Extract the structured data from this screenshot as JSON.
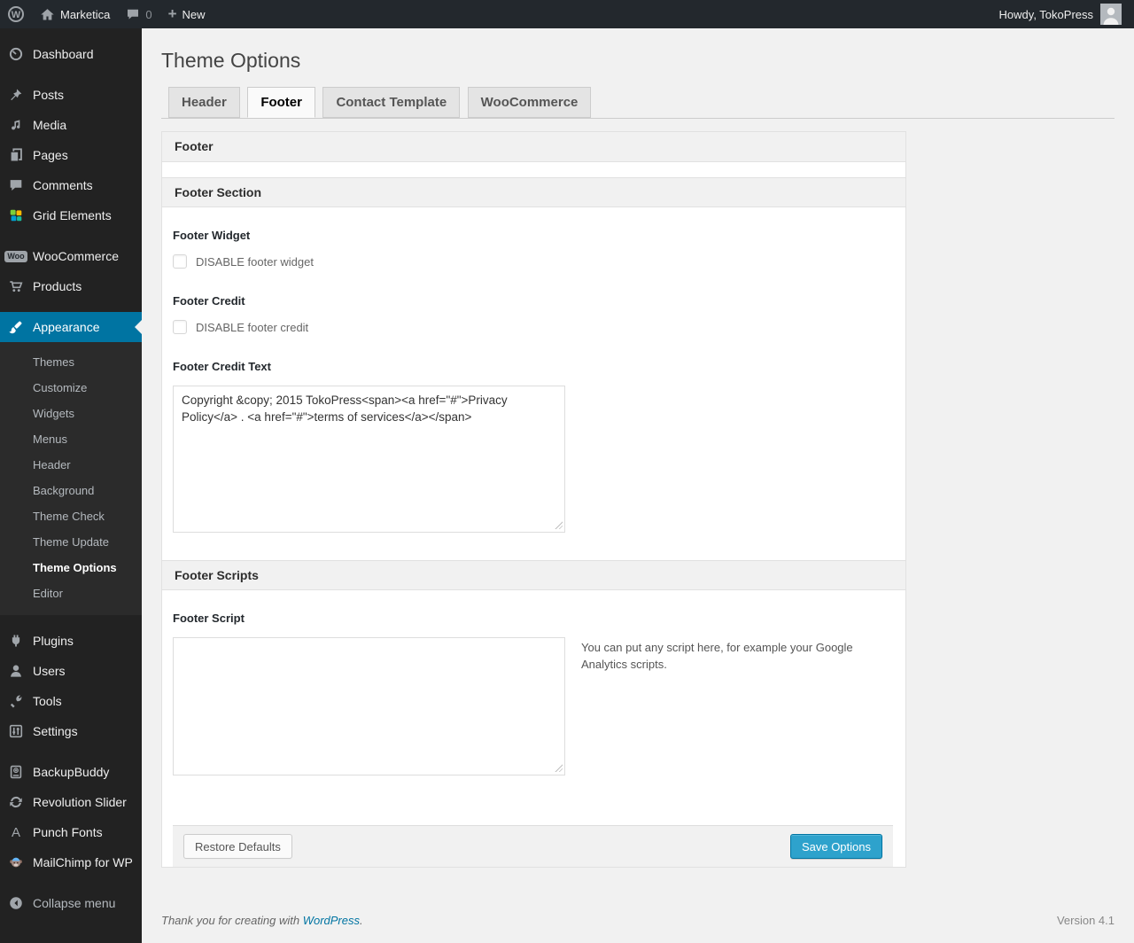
{
  "admin_bar": {
    "wp_logo_letter": "W",
    "site_name": "Marketica",
    "comment_count": "0",
    "new_plus_glyph": "+",
    "new_label": "New",
    "howdy_text": "Howdy, TokoPress"
  },
  "sidebar": {
    "items": [
      {
        "label": "Dashboard",
        "icon": "dashboard-icon"
      },
      {
        "label": "Posts",
        "icon": "pushpin-icon"
      },
      {
        "label": "Media",
        "icon": "media-icon"
      },
      {
        "label": "Pages",
        "icon": "pages-icon"
      },
      {
        "label": "Comments",
        "icon": "comment-icon"
      },
      {
        "label": "Grid Elements",
        "icon": "grid-elements-icon"
      },
      {
        "label": "WooCommerce",
        "icon": "woocommerce-badge-icon",
        "badge_text": "Woo"
      },
      {
        "label": "Products",
        "icon": "cart-icon"
      },
      {
        "label": "Appearance",
        "icon": "brush-icon",
        "active": true
      },
      {
        "label": "Plugins",
        "icon": "plug-icon"
      },
      {
        "label": "Users",
        "icon": "user-icon"
      },
      {
        "label": "Tools",
        "icon": "wrench-icon"
      },
      {
        "label": "Settings",
        "icon": "sliders-icon"
      },
      {
        "label": "BackupBuddy",
        "icon": "backup-drive-icon"
      },
      {
        "label": "Revolution Slider",
        "icon": "refresh-icon"
      },
      {
        "label": "Punch Fonts",
        "icon": "letter-a-icon",
        "badge_text": "A"
      },
      {
        "label": "MailChimp for WP",
        "icon": "monkey-icon"
      },
      {
        "label": "Collapse menu",
        "icon": "collapse-arrow-icon"
      }
    ],
    "appearance_submenu": [
      {
        "label": "Themes"
      },
      {
        "label": "Customize"
      },
      {
        "label": "Widgets"
      },
      {
        "label": "Menus"
      },
      {
        "label": "Header"
      },
      {
        "label": "Background"
      },
      {
        "label": "Theme Check"
      },
      {
        "label": "Theme Update"
      },
      {
        "label": "Theme Options",
        "current": true
      },
      {
        "label": "Editor"
      }
    ]
  },
  "main": {
    "page_title": "Theme Options",
    "tabs": [
      {
        "label": "Header",
        "active": false
      },
      {
        "label": "Footer",
        "active": true
      },
      {
        "label": "Contact Template",
        "active": false
      },
      {
        "label": "WooCommerce",
        "active": false
      }
    ],
    "panel": {
      "title_bar": "Footer",
      "section_title": "Footer Section",
      "footer_widget_label": "Footer Widget",
      "footer_widget_checkbox_label": "DISABLE footer widget",
      "footer_widget_checked": false,
      "footer_credit_label": "Footer Credit",
      "footer_credit_checkbox_label": "DISABLE footer credit",
      "footer_credit_checked": false,
      "footer_credit_text_label": "Footer Credit Text",
      "footer_credit_text_value": "Copyright &copy; 2015 TokoPress<span><a href=\"#\">Privacy Policy</a> . <a href=\"#\">terms of services</a></span>",
      "scripts_section_title": "Footer Scripts",
      "footer_script_label": "Footer Script",
      "footer_script_value": "",
      "footer_script_help": "You can put any script here, for example your Google Analytics scripts.",
      "restore_button_label": "Restore Defaults",
      "save_button_label": "Save Options"
    },
    "footer": {
      "thanks_text": "Thank you for creating with",
      "wordpress_link_label": "WordPress",
      "period": ".",
      "version": "Version 4.1"
    }
  },
  "colors": {
    "accent_blue": "#0074a2",
    "save_button_blue": "#2ea2cc",
    "admin_bar_bg": "#23282d",
    "sidebar_bg": "#222222",
    "content_bg": "#f1f1f1"
  }
}
